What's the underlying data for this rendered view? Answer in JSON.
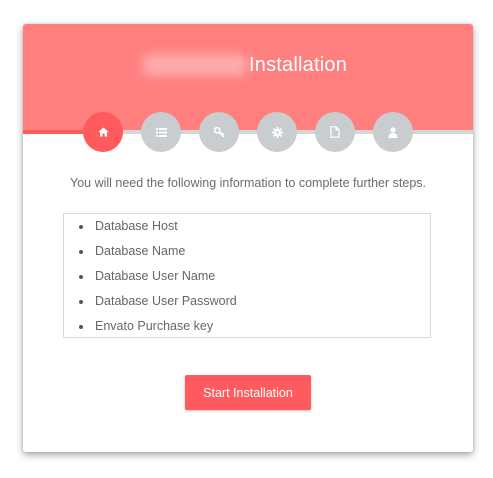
{
  "header": {
    "title": "Installation",
    "background_color": "#ff7f7f"
  },
  "steps": [
    {
      "icon": "home-icon",
      "state": "active"
    },
    {
      "icon": "list-icon",
      "state": "inactive"
    },
    {
      "icon": "key-icon",
      "state": "inactive"
    },
    {
      "icon": "gear-icon",
      "state": "inactive"
    },
    {
      "icon": "file-icon",
      "state": "inactive"
    },
    {
      "icon": "user-icon",
      "state": "inactive"
    }
  ],
  "progress": {
    "completed_steps": 1,
    "total_steps": 6
  },
  "intro_text": "You will need the following information to complete further steps.",
  "requirements": [
    "Database Host",
    "Database Name",
    "Database User Name",
    "Database User Password",
    "Envato Purchase key"
  ],
  "start_button": {
    "label": "Start Installation"
  },
  "colors": {
    "accent": "#ff5b5e",
    "inactive_step": "#c9cdd0",
    "text": "#666666"
  }
}
